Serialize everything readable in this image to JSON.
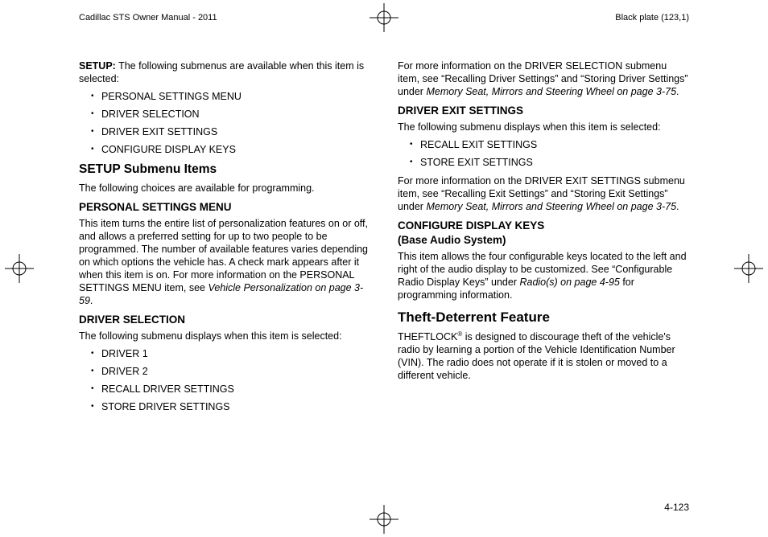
{
  "header": {
    "left": "Cadillac STS Owner Manual - 2011",
    "right": "Black plate (123,1)"
  },
  "page_number": "4-123",
  "left_col": {
    "setup_label": "SETUP:",
    "setup_text": " The following submenus are available when this item is selected:",
    "setup_items": [
      "PERSONAL SETTINGS MENU",
      "DRIVER SELECTION",
      "DRIVER EXIT SETTINGS",
      "CONFIGURE DISPLAY KEYS"
    ],
    "submenu_heading": "SETUP Submenu Items",
    "submenu_intro": "The following choices are available for programming.",
    "psm_heading": "PERSONAL SETTINGS MENU",
    "psm_text": "This item turns the entire list of personalization features on or off, and allows a preferred setting for up to two people to be programmed. The number of available features varies depending on which options the vehicle has. A check mark appears after it when this item is on. For more information on the PERSONAL SETTINGS MENU item, see ",
    "psm_link": "Vehicle Personalization on page 3-59",
    "psm_period": ".",
    "ds_heading": "DRIVER SELECTION",
    "ds_intro": "The following submenu displays when this item is selected:",
    "ds_items": [
      "DRIVER 1",
      "DRIVER 2",
      "RECALL DRIVER SETTINGS",
      "STORE DRIVER SETTINGS"
    ]
  },
  "right_col": {
    "ds_more_1": "For more information on the DRIVER SELECTION submenu item, see “Recalling Driver Settings” and “Storing Driver Settings” under ",
    "ds_more_link": "Memory Seat, Mirrors and Steering Wheel on page 3-75",
    "ds_more_2": ".",
    "des_heading": "DRIVER EXIT SETTINGS",
    "des_intro": "The following submenu displays when this item is selected:",
    "des_items": [
      "RECALL EXIT SETTINGS",
      "STORE EXIT SETTINGS"
    ],
    "des_more_1": "For more information on the DRIVER EXIT SETTINGS submenu item, see “Recalling Exit Settings” and “Storing Exit Settings” under ",
    "des_more_link": "Memory Seat, Mirrors and Steering Wheel on page 3-75",
    "des_more_2": ".",
    "cdk_heading_1": "CONFIGURE DISPLAY KEYS",
    "cdk_heading_2": "(Base Audio System)",
    "cdk_text_1": "This item allows the four configurable keys located to the left and right of the audio display to be customized. See “Configurable Radio Display Keys” under ",
    "cdk_link": "Radio(s) on page 4-95",
    "cdk_text_2": " for programming information.",
    "theft_heading": "Theft-Deterrent Feature",
    "theft_label": "THEFTLOCK",
    "theft_text": " is designed to discourage theft of the vehicle's radio by learning a portion of the Vehicle Identification Number (VIN). The radio does not operate if it is stolen or moved to a different vehicle."
  }
}
